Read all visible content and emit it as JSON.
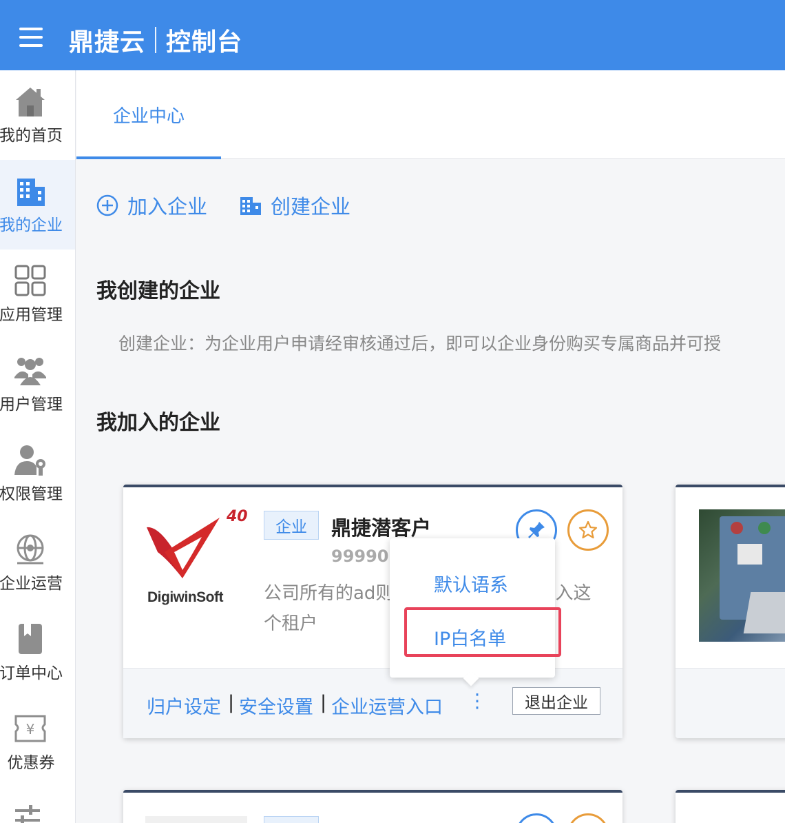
{
  "header": {
    "brand": "鼎捷云",
    "section": "控制台"
  },
  "sidebar": {
    "items": [
      {
        "label": "我的首页",
        "icon": "home-icon"
      },
      {
        "label": "我的企业",
        "icon": "building-icon",
        "active": true
      },
      {
        "label": "应用管理",
        "icon": "app-grid-icon"
      },
      {
        "label": "用户管理",
        "icon": "users-icon"
      },
      {
        "label": "权限管理",
        "icon": "user-key-icon"
      },
      {
        "label": "企业运营",
        "icon": "globe-icon"
      },
      {
        "label": "订单中心",
        "icon": "bookmark-icon"
      },
      {
        "label": "优惠券",
        "icon": "coupon-icon"
      }
    ]
  },
  "tabs": [
    {
      "label": "企业中心"
    }
  ],
  "actions": {
    "join": "加入企业",
    "create": "创建企业"
  },
  "sections": {
    "created_title": "我创建的企业",
    "created_desc": "创建企业：为企业用户申请经审核通过后，即可以企业身份购买专属商品并可授",
    "joined_title": "我加入的企业"
  },
  "card": {
    "logo_text": "DigiwinSoft",
    "logo_badge": "40",
    "type_badge": "企业",
    "name": "鼎捷潜客户",
    "id": "99990(",
    "desc_line1": "公司所有的ad则",
    "desc_line1_tail": "入这",
    "desc_line2": "个租户",
    "footer": {
      "link1": "归户设定",
      "link2": "安全设置",
      "link3": "企业运营入口",
      "sep": "|",
      "more": "⋮",
      "quit": "退出企业"
    }
  },
  "popup": {
    "item1": "默认语系",
    "item2": "IP白名单"
  },
  "colors": {
    "primary": "#3e8ae8",
    "highlight": "#e8435a",
    "star": "#e89c3a"
  }
}
